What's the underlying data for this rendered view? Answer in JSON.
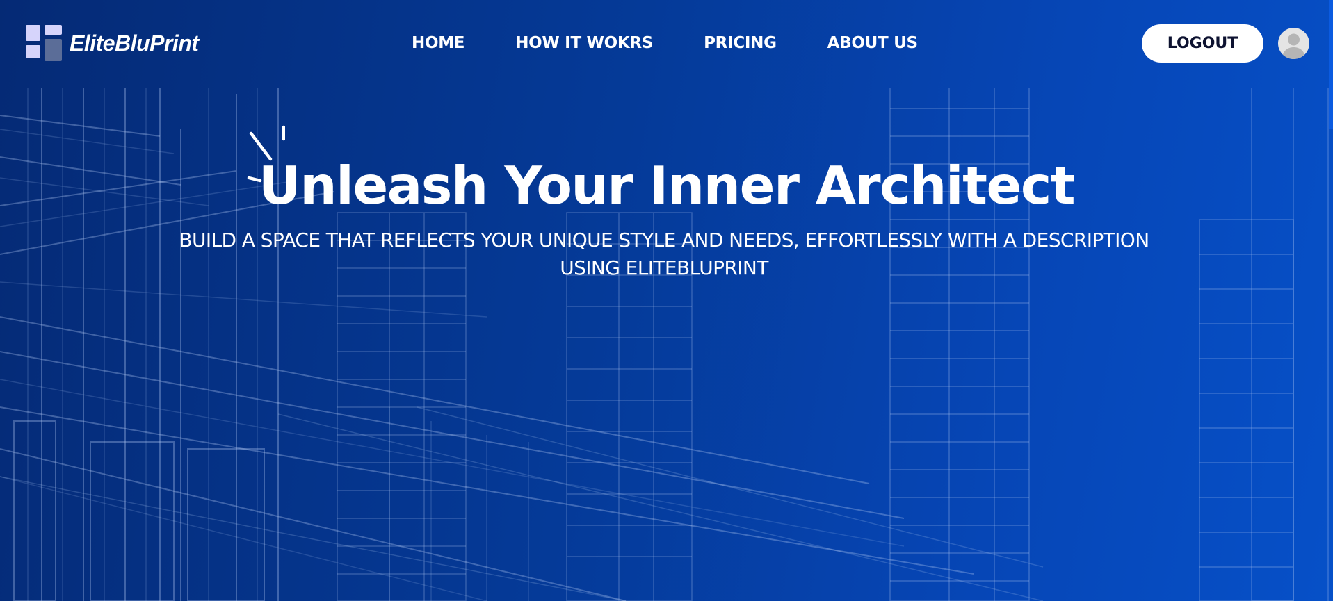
{
  "brand": {
    "name": "EliteBluPrint",
    "logo_icon": "grid-blocks-icon",
    "logo_colors": [
      "#d6d4fb",
      "#d6d4fb",
      "#d6d4fb",
      "#5b6d98"
    ]
  },
  "nav": {
    "items": [
      {
        "label": "HOME"
      },
      {
        "label": "HOW IT WOKRS"
      },
      {
        "label": "PRICING"
      },
      {
        "label": "ABOUT US"
      }
    ]
  },
  "header": {
    "logout_label": "LOGOUT",
    "avatar_icon": "user-avatar-icon"
  },
  "hero": {
    "title": "Unleash Your Inner Architect",
    "subtitle": "BUILD A SPACE THAT REFLECTS YOUR UNIQUE STYLE AND NEEDS, EFFORTLESSLY WITH A DESCRIPTION USING ELITEBLUPRINT",
    "sparkle_icon": "sparkle-icon",
    "background_image": "wireframe-buildings"
  },
  "colors": {
    "background_start": "#052a75",
    "background_end": "#0650c8",
    "text": "#ffffff",
    "button_bg": "#ffffff",
    "button_text": "#0d1230"
  }
}
